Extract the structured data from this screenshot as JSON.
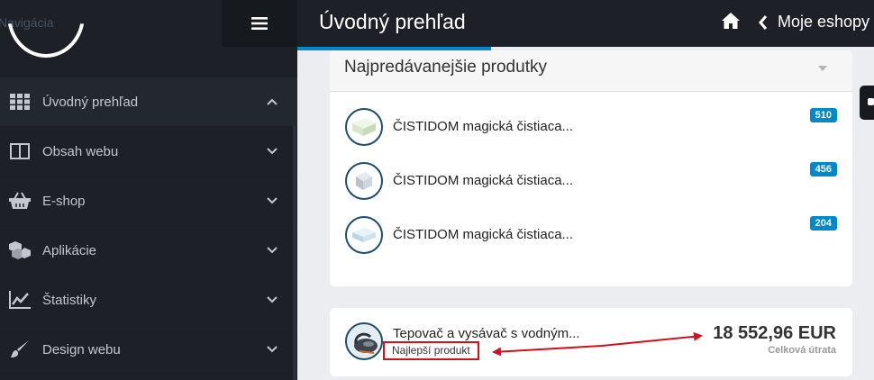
{
  "sidebar": {
    "nav_title": "Navigácia",
    "items": [
      {
        "label": "Úvodný prehľad",
        "icon": "grid-icon"
      },
      {
        "label": "Obsah webu",
        "icon": "columns-icon"
      },
      {
        "label": "E-shop",
        "icon": "basket-icon"
      },
      {
        "label": "Aplikácie",
        "icon": "cubes-icon"
      },
      {
        "label": "Štatistiky",
        "icon": "line-chart-icon"
      },
      {
        "label": "Design webu",
        "icon": "brush-icon"
      }
    ]
  },
  "header": {
    "title": "Úvodný prehľad",
    "eshops_link": "Moje eshopy"
  },
  "top_products": {
    "title": "Najpredávanejšie produtky",
    "items": [
      {
        "name": "ČISTIDOM magická čistiaca...",
        "count": "510"
      },
      {
        "name": "ČISTIDOM magická čistiaca...",
        "count": "456"
      },
      {
        "name": "ČISTIDOM magická čistiaca...",
        "count": "204"
      }
    ]
  },
  "best_product": {
    "name": "Tepovač a vysávač s vodným...",
    "tag": "Najlepší produkt",
    "total_value": "18 552,96 EUR",
    "total_label": "Celková útrata"
  },
  "colors": {
    "accent": "#0088cc",
    "sidebar_bg": "#1d2127",
    "annotation_red": "#d0101c"
  }
}
